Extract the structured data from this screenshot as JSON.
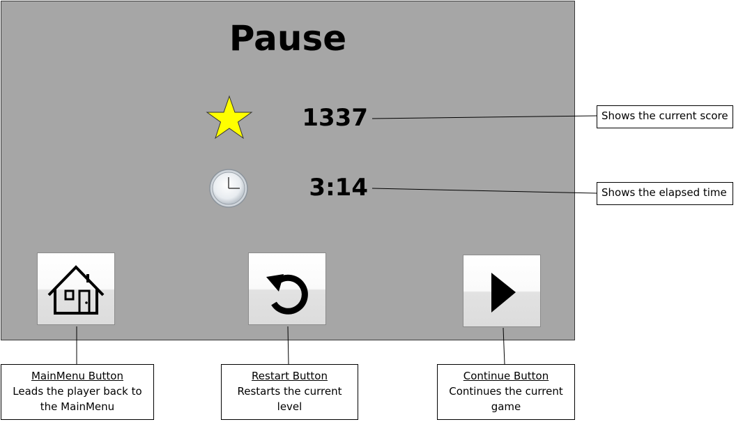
{
  "pause_screen": {
    "title": "Pause",
    "score": {
      "icon": "star-icon",
      "value": "1337"
    },
    "time": {
      "icon": "clock-icon",
      "value": "3:14"
    },
    "buttons": [
      {
        "id": "main-menu",
        "icon": "house-icon"
      },
      {
        "id": "restart",
        "icon": "restart-icon"
      },
      {
        "id": "continue",
        "icon": "play-icon"
      }
    ]
  },
  "annotations": {
    "score": "Shows the current score",
    "time": "Shows the elapsed time",
    "main_menu": {
      "caption": "MainMenu Button",
      "lines": [
        "Leads the player back to",
        "the MainMenu"
      ]
    },
    "restart": {
      "caption": "Restart Button",
      "lines": [
        "Restarts the current",
        "level"
      ]
    },
    "continue": {
      "caption": "Continue Button",
      "lines": [
        "Continues the current",
        "game"
      ]
    }
  },
  "colors": {
    "screen_bg": "#a6a6a6",
    "star_fill": "#ffff00",
    "text": "#000000"
  }
}
